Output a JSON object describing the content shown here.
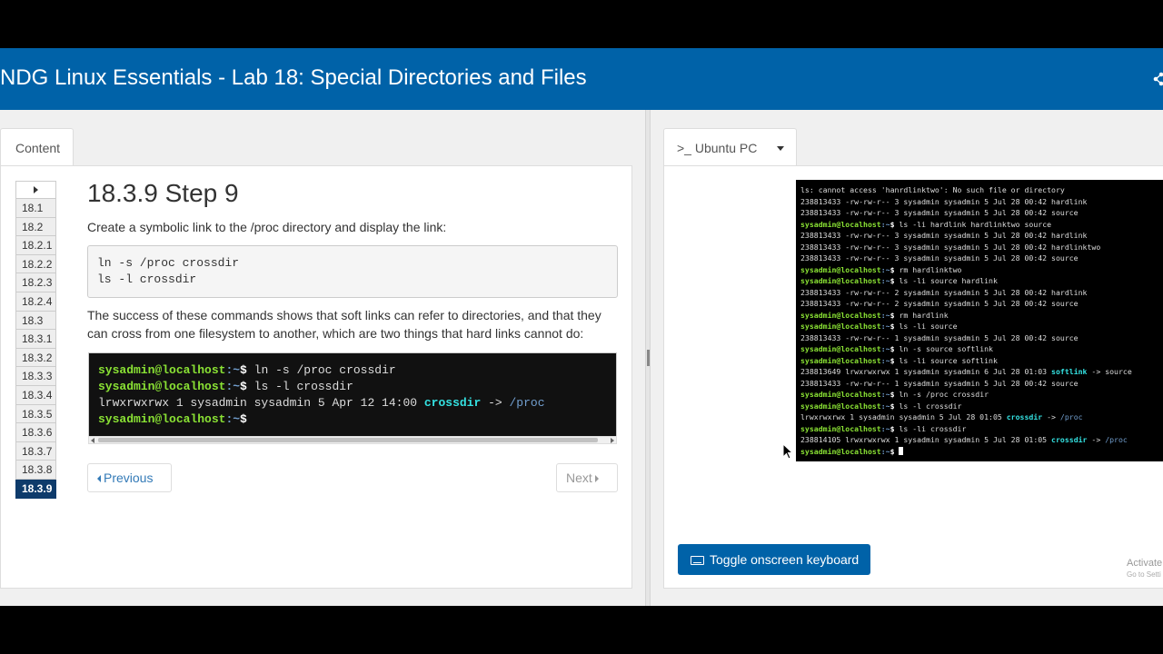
{
  "header": {
    "title": "NDG Linux Essentials - Lab 18: Special Directories and Files"
  },
  "left_tab": {
    "label": "Content"
  },
  "step_nav": {
    "items": [
      "18.1",
      "18.2",
      "18.2.1",
      "18.2.2",
      "18.2.3",
      "18.2.4",
      "18.3",
      "18.3.1",
      "18.3.2",
      "18.3.3",
      "18.3.4",
      "18.3.5",
      "18.3.6",
      "18.3.7",
      "18.3.8",
      "18.3.9"
    ],
    "active": "18.3.9"
  },
  "lesson": {
    "title": "18.3.9 Step 9",
    "intro": "Create a symbolic link to the /proc directory and display the link:",
    "code": [
      "ln -s /proc crossdir",
      "ls -l crossdir"
    ],
    "explanation": "The success of these commands shows that soft links can refer to directories, and that they can cross from one filesystem to another, which are two things that hard links cannot do:",
    "terminal": {
      "prompt_user": "sysadmin@localhost",
      "prompt_path": ":~",
      "prompt_sign": "$",
      "cmd1": " ln -s /proc crossdir",
      "cmd2": " ls -l crossdir",
      "out_prefix": "lrwxrwxrwx 1 sysadmin sysadmin 5 Apr 12 14:00 ",
      "out_link": "crossdir",
      "out_arrow": " -> ",
      "out_target": "/proc"
    },
    "prev_label": "Previous",
    "next_label": "Next"
  },
  "vm": {
    "tab_label": ">_ Ubuntu PC",
    "terminal_lines": [
      {
        "type": "out",
        "text": "ls: cannot access 'hanrdlinktwo': No such file or directory"
      },
      {
        "type": "out",
        "text": "238813433 -rw-rw-r-- 3 sysadmin sysadmin 5 Jul 28 00:42 hardlink"
      },
      {
        "type": "out",
        "text": "238813433 -rw-rw-r-- 3 sysadmin sysadmin 5 Jul 28 00:42 source"
      },
      {
        "type": "cmd",
        "text": " ls -li hardlink hardlinktwo source"
      },
      {
        "type": "out",
        "text": "238813433 -rw-rw-r-- 3 sysadmin sysadmin 5 Jul 28 00:42 hardlink"
      },
      {
        "type": "out",
        "text": "238813433 -rw-rw-r-- 3 sysadmin sysadmin 5 Jul 28 00:42 hardlinktwo"
      },
      {
        "type": "out",
        "text": "238813433 -rw-rw-r-- 3 sysadmin sysadmin 5 Jul 28 00:42 source"
      },
      {
        "type": "cmd",
        "text": " rm hardlinktwo"
      },
      {
        "type": "cmd",
        "text": " ls -li source hardlink"
      },
      {
        "type": "out",
        "text": "238813433 -rw-rw-r-- 2 sysadmin sysadmin 5 Jul 28 00:42 hardlink"
      },
      {
        "type": "out",
        "text": "238813433 -rw-rw-r-- 2 sysadmin sysadmin 5 Jul 28 00:42 source"
      },
      {
        "type": "cmd",
        "text": " rm hardlink"
      },
      {
        "type": "cmd",
        "text": " ls -li source"
      },
      {
        "type": "out",
        "text": "238813433 -rw-rw-r-- 1 sysadmin sysadmin 5 Jul 28 00:42 source"
      },
      {
        "type": "cmd",
        "text": " ln -s source softlink"
      },
      {
        "type": "cmd",
        "text": " ls -li source softlink"
      },
      {
        "type": "link",
        "text": "238813649 lrwxrwxrwx 1 sysadmin sysadmin 6 Jul 28 01:03 ",
        "link": "softlink",
        "arrow": " -> source",
        "target": ""
      },
      {
        "type": "out",
        "text": "238813433 -rw-rw-r-- 1 sysadmin sysadmin 5 Jul 28 00:42 source"
      },
      {
        "type": "cmd",
        "text": " ln -s /proc crossdir"
      },
      {
        "type": "cmd",
        "text": " ls -l crossdir"
      },
      {
        "type": "link",
        "text": "lrwxrwxrwx 1 sysadmin sysadmin 5 Jul 28 01:05 ",
        "link": "crossdir",
        "arrow": " -> ",
        "target": "/proc"
      },
      {
        "type": "cmd",
        "text": " ls -li crossdir"
      },
      {
        "type": "link",
        "text": "238814105 lrwxrwxrwx 1 sysadmin sysadmin 5 Jul 28 01:05 ",
        "link": "crossdir",
        "arrow": " -> ",
        "target": "/proc"
      },
      {
        "type": "prompt",
        "text": " "
      }
    ],
    "prompt": "sysadmin@localhost:~$",
    "keyboard_label": "Toggle onscreen keyboard",
    "activate_text": "Activate",
    "activate_sub": "Go to Setti"
  }
}
